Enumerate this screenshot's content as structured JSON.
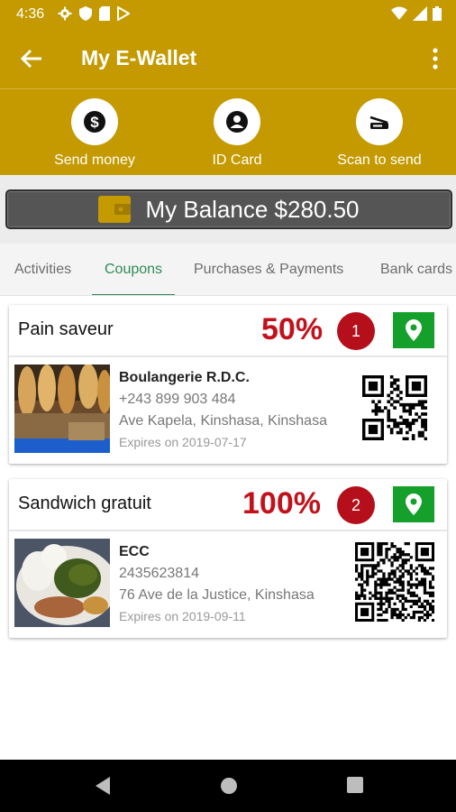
{
  "status_bar": {
    "time": "4:36"
  },
  "app_bar": {
    "title": "My E-Wallet"
  },
  "actions": [
    {
      "label": "Send money",
      "icon": "dollar-icon"
    },
    {
      "label": "ID Card",
      "icon": "person-icon"
    },
    {
      "label": "Scan to send",
      "icon": "scanner-icon"
    }
  ],
  "balance": {
    "text": "My Balance $280.50"
  },
  "tabs": [
    {
      "label": "Activities",
      "active": false
    },
    {
      "label": "Coupons",
      "active": true
    },
    {
      "label": "Purchases & Payments",
      "active": false
    },
    {
      "label": "Bank cards",
      "active": false
    }
  ],
  "coupons": [
    {
      "name": "Pain saveur",
      "discount": "50%",
      "number": "1",
      "merchant": "Boulangerie R.D.C.",
      "phone": "+243 899 903 484",
      "address": "Ave Kapela, Kinshasa, Kinshasa",
      "expires": "Expires on 2019-07-17"
    },
    {
      "name": "Sandwich gratuit",
      "discount": "100%",
      "number": "2",
      "merchant": "ECC",
      "phone": "2435623814",
      "address": "76 Ave de la Justice, Kinshasa",
      "expires": "Expires on 2019-09-11"
    }
  ],
  "colors": {
    "primary": "#c49a00",
    "tab_active": "#2e8b57",
    "discount": "#c1121c",
    "badge": "#b40f1a",
    "location_button": "#14a02b"
  }
}
